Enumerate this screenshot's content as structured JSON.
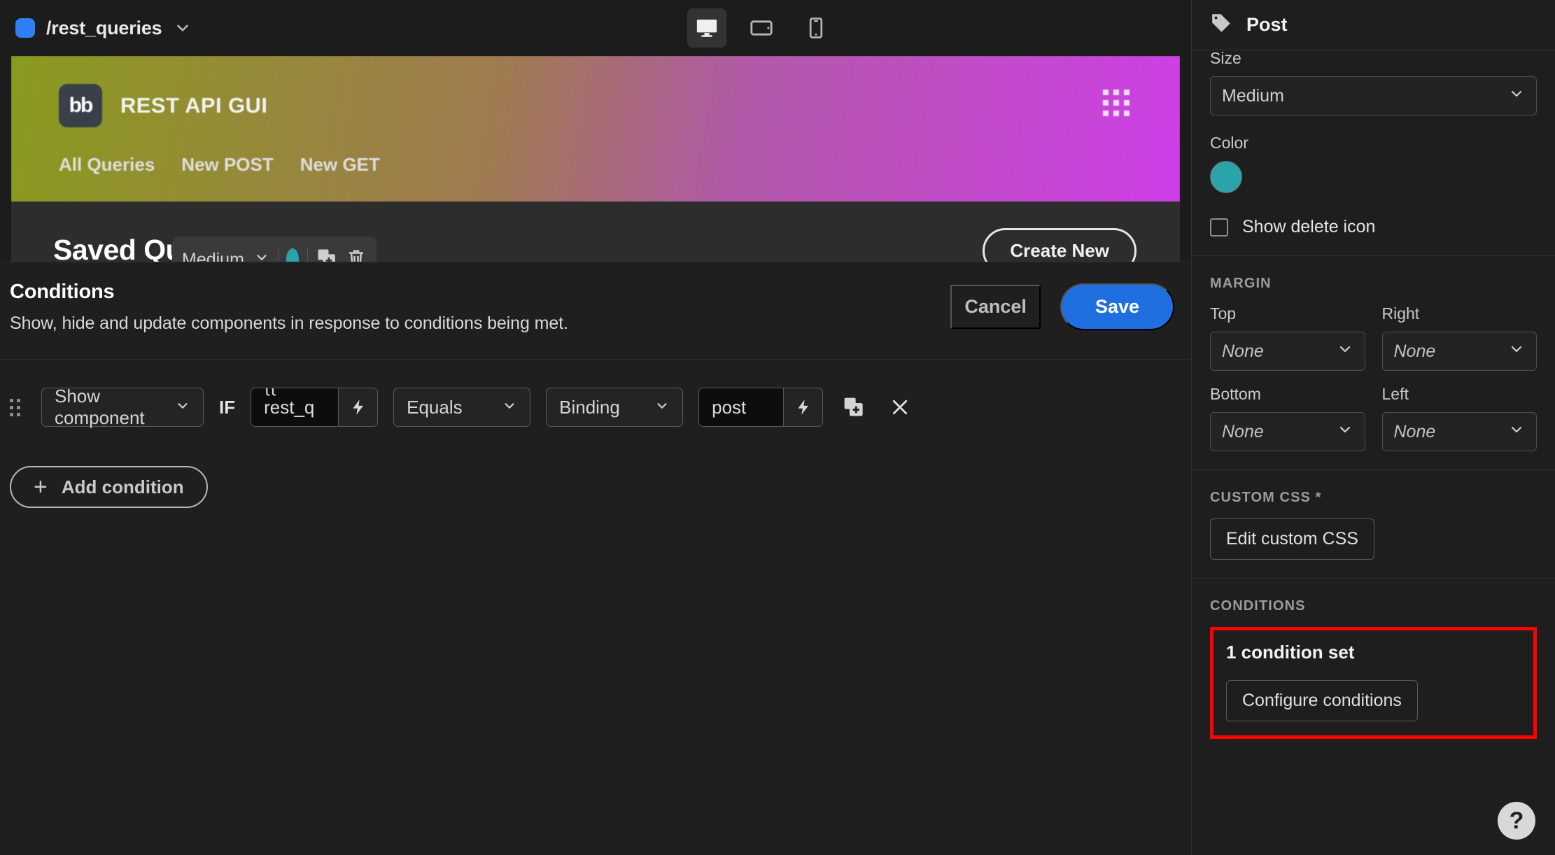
{
  "topbar": {
    "route": "/rest_queries",
    "route_chevron": "chevron-down",
    "devices": [
      {
        "name": "desktop",
        "active": true
      },
      {
        "name": "tablet",
        "active": false
      },
      {
        "name": "mobile",
        "active": false
      }
    ]
  },
  "preview": {
    "brand_logo": "bb",
    "brand_title": "REST API GUI",
    "nav": [
      "All Queries",
      "New POST",
      "New GET"
    ],
    "section_title": "Saved Queries",
    "create_new_label": "Create New",
    "floating_toolbar": {
      "size_value": "Medium",
      "color_hex": "#2aa3aa",
      "duplicate_icon": "duplicate-icon",
      "delete_icon": "trash-icon"
    },
    "gradient_from": "#8a9a1e",
    "gradient_to": "#cf3ee8"
  },
  "modal": {
    "title": "Conditions",
    "subtitle": "Show, hide and update components in response to conditions being met.",
    "cancel_label": "Cancel",
    "save_label": "Save",
    "save_color": "#1f6fe0",
    "add_condition_label": "Add condition",
    "condition": {
      "action": "Show component",
      "if_label": "IF",
      "reference_value": "{{ rest_q ...",
      "operator": "Equals",
      "value_type": "Binding",
      "value": "post",
      "bolt_icon": "lightning-icon",
      "duplicate_icon": "duplicate-icon",
      "remove_icon": "close-icon",
      "drag_icon": "drag-handle-icon"
    }
  },
  "panel": {
    "header_title": "Post",
    "header_icon": "tag-icon",
    "size": {
      "label": "Size",
      "value": "Medium"
    },
    "color": {
      "label": "Color",
      "value": "#2aa3aa"
    },
    "show_delete": {
      "label": "Show delete icon",
      "checked": false
    },
    "margin": {
      "section_label": "MARGIN",
      "fields": [
        {
          "label": "Top",
          "value": "None"
        },
        {
          "label": "Right",
          "value": "None"
        },
        {
          "label": "Bottom",
          "value": "None"
        },
        {
          "label": "Left",
          "value": "None"
        }
      ]
    },
    "custom_css": {
      "section_label": "CUSTOM CSS *",
      "button_label": "Edit custom CSS"
    },
    "conditions": {
      "section_label": "CONDITIONS",
      "count_text": "1 condition set",
      "button_label": "Configure conditions",
      "highlight_color": "#ff0000"
    },
    "help_label": "?"
  }
}
